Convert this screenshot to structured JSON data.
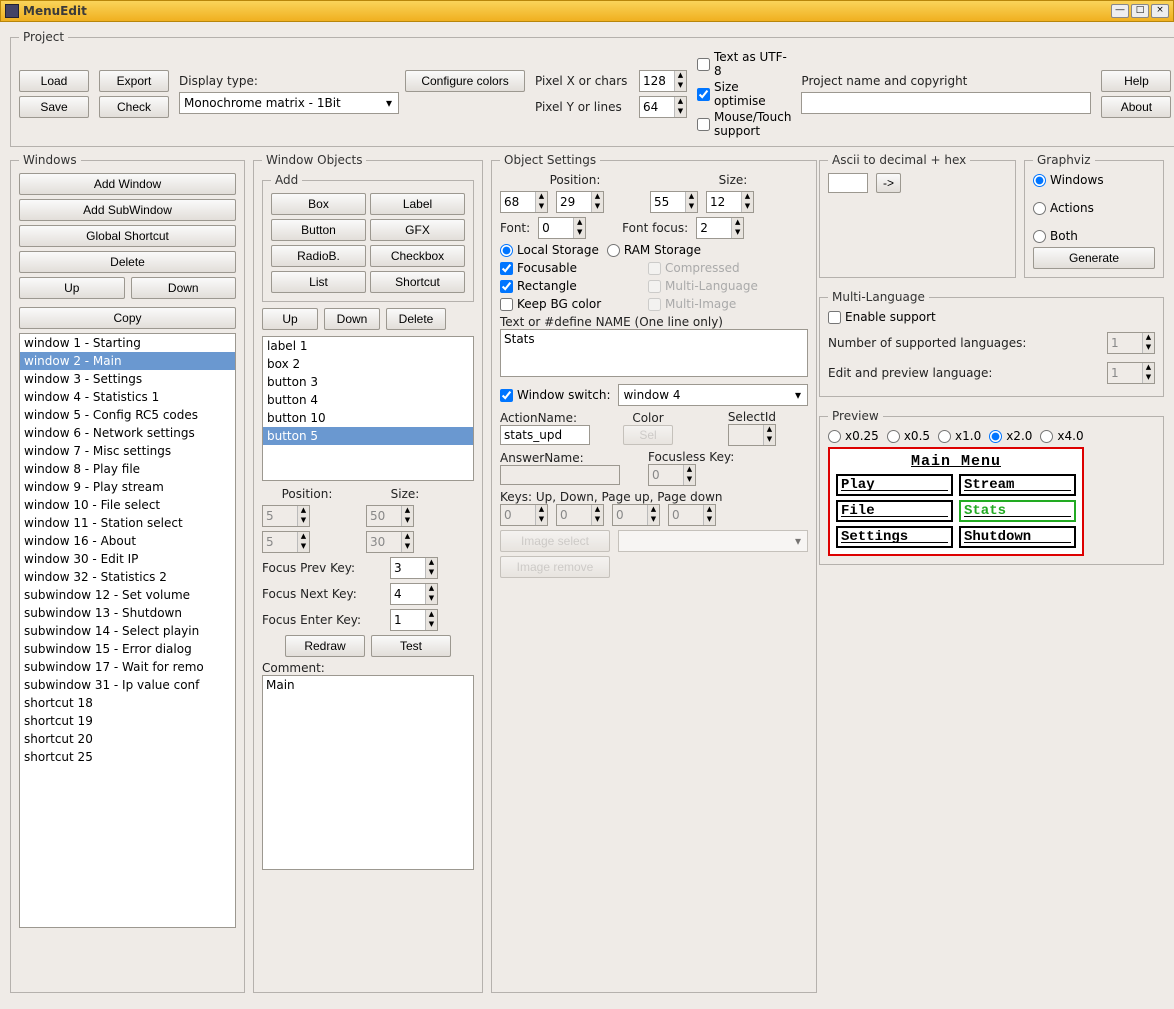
{
  "window": {
    "title": "MenuEdit"
  },
  "project": {
    "legend": "Project",
    "load": "Load",
    "export": "Export",
    "save": "Save",
    "check": "Check",
    "display_type_label": "Display type:",
    "configure_colors": "Configure colors",
    "display_type_value": "Monochrome matrix - 1Bit",
    "pixel_x_label": "Pixel X or chars",
    "pixel_x": "128",
    "pixel_y_label": "Pixel Y or lines",
    "pixel_y": "64",
    "text_utf8": "Text as UTF-8",
    "size_optimise": "Size optimise",
    "mouse_touch": "Mouse/Touch support",
    "project_name_label": "Project name and copyright",
    "project_name_value": "",
    "help": "Help",
    "about": "About"
  },
  "windows_panel": {
    "legend": "Windows",
    "add_window": "Add Window",
    "add_subwindow": "Add SubWindow",
    "global_shortcut": "Global Shortcut",
    "delete": "Delete",
    "up": "Up",
    "down": "Down",
    "copy": "Copy",
    "items": [
      "window 1 - Starting",
      "window 2 - Main",
      "window 3 - Settings",
      "window 4 - Statistics 1",
      "window 5 - Config RC5 codes",
      "window 6 - Network settings",
      "window 7 - Misc settings",
      "window 8 - Play file",
      "window 9 - Play stream",
      "window 10 - File select",
      "window 11 - Station select",
      "window 16 - About",
      "window 30 - Edit IP",
      "window 32 - Statistics 2",
      "subwindow 12 - Set volume",
      "subwindow 13 - Shutdown",
      "subwindow 14 - Select playin",
      "subwindow 15 - Error dialog",
      "subwindow 17 - Wait for remo",
      "subwindow 31 - Ip value conf",
      "shortcut 18",
      "shortcut 19",
      "shortcut 20",
      "shortcut 25"
    ],
    "selected_index": 1
  },
  "winobj": {
    "legend": "Window Objects",
    "add_legend": "Add",
    "box": "Box",
    "label": "Label",
    "button": "Button",
    "gfx": "GFX",
    "radio": "RadioB.",
    "checkbox": "Checkbox",
    "list": "List",
    "shortcut": "Shortcut",
    "up": "Up",
    "down": "Down",
    "delete": "Delete",
    "items": [
      "label 1",
      "box 2",
      "button 3",
      "button 4",
      "button 10",
      "button 5"
    ],
    "selected_index": 5,
    "pos_label": "Position:",
    "size_label": "Size:",
    "pos_x": "5",
    "pos_y": "5",
    "size_w": "50",
    "size_h": "30",
    "focus_prev": "Focus Prev Key:",
    "focus_prev_v": "3",
    "focus_next": "Focus Next Key:",
    "focus_next_v": "4",
    "focus_enter": "Focus Enter Key:",
    "focus_enter_v": "1",
    "redraw": "Redraw",
    "test": "Test",
    "comment_label": "Comment:",
    "comment_value": "Main"
  },
  "objset": {
    "legend": "Object Settings",
    "position": "Position:",
    "size": "Size:",
    "px": "68",
    "py": "29",
    "sw": "55",
    "sh": "12",
    "font": "Font:",
    "font_v": "0",
    "font_focus": "Font focus:",
    "font_focus_v": "2",
    "local_storage": "Local Storage",
    "ram_storage": "RAM Storage",
    "focusable": "Focusable",
    "compressed": "Compressed",
    "rectangle": "Rectangle",
    "multilang": "Multi-Language",
    "keep_bg": "Keep BG color",
    "multiimg": "Multi-Image",
    "text_label": "Text or #define NAME (One line only)",
    "text_value": "Stats",
    "win_switch": "Window switch:",
    "win_switch_value": "window 4",
    "action": "ActionName:",
    "action_v": "stats_upd",
    "color": "Color",
    "sel": "Sel",
    "selectid": "SelectId",
    "selectid_v": "",
    "answer": "AnswerName:",
    "answer_v": "",
    "focusless": "Focusless Key:",
    "focusless_v": "0",
    "keys_label": "Keys: Up, Down, Page up, Page down",
    "k1": "0",
    "k2": "0",
    "k3": "0",
    "k4": "0",
    "image_select": "Image select",
    "image_remove": "Image remove"
  },
  "ascii": {
    "legend": "Ascii to decimal + hex",
    "go": "->",
    "value": ""
  },
  "graphviz": {
    "legend": "Graphviz",
    "windows": "Windows",
    "actions": "Actions",
    "both": "Both",
    "generate": "Generate"
  },
  "multilang": {
    "legend": "Multi-Language",
    "enable": "Enable support",
    "num_label": "Number of supported languages:",
    "num_v": "1",
    "edit_label": "Edit and preview language:",
    "edit_v": "1"
  },
  "preview": {
    "legend": "Preview",
    "zooms": [
      "x0.25",
      "x0.5",
      "x1.0",
      "x2.0",
      "x4.0"
    ],
    "zoom_selected": 3,
    "title": "Main Menu",
    "cells": [
      "Play",
      "Stream",
      "File",
      "Stats",
      "Settings",
      "Shutdown"
    ],
    "highlight_index": 3
  }
}
